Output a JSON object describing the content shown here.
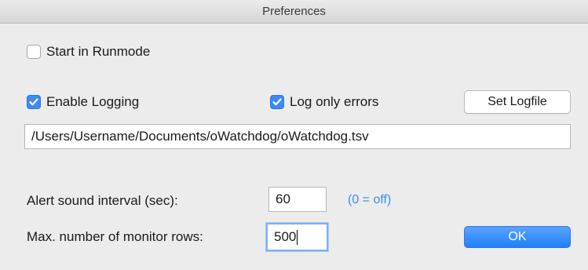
{
  "window": {
    "title": "Preferences"
  },
  "options": {
    "start_in_runmode": {
      "label": "Start in Runmode",
      "checked": false
    },
    "enable_logging": {
      "label": "Enable Logging",
      "checked": true
    },
    "log_only_errors": {
      "label": "Log only errors",
      "checked": true
    }
  },
  "logfile": {
    "button_label": "Set Logfile",
    "path": "/Users/Username/Documents/oWatchdog/oWatchdog.tsv"
  },
  "alert": {
    "label": "Alert sound interval (sec):",
    "value": "60",
    "hint": "(0 = off)"
  },
  "monitor_rows": {
    "label": "Max. number of monitor rows:",
    "value": "500"
  },
  "ok_button": {
    "label": "OK"
  },
  "colors": {
    "accent": "#3b8af5",
    "window_bg": "#ececec"
  },
  "icons": {
    "checkbox_checked": "checkmark-icon"
  }
}
